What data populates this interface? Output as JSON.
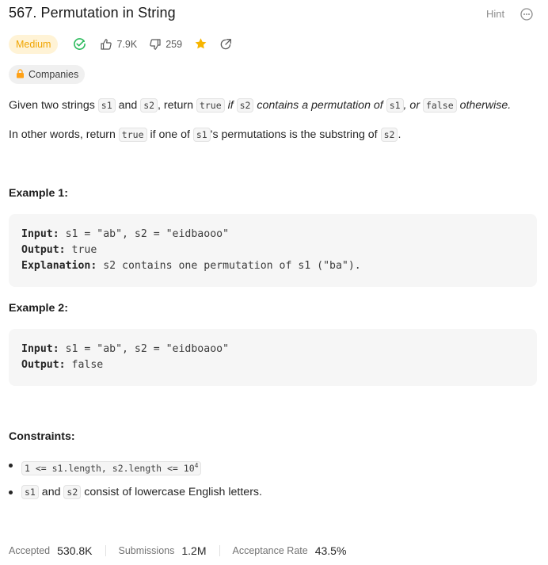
{
  "problem": {
    "title": "567. Permutation in String",
    "hint_label": "Hint",
    "difficulty": "Medium",
    "likes": "7.9K",
    "dislikes": "259",
    "companies_label": "Companies"
  },
  "description": {
    "p1": [
      {
        "t": "Given two strings ",
        "s": "text"
      },
      {
        "t": "s1",
        "s": "code"
      },
      {
        "t": " and ",
        "s": "text"
      },
      {
        "t": "s2",
        "s": "code"
      },
      {
        "t": ", return ",
        "s": "text"
      },
      {
        "t": "true",
        "s": "code"
      },
      {
        "t": " if ",
        "s": "it"
      },
      {
        "t": "s2",
        "s": "code"
      },
      {
        "t": " contains a permutation of ",
        "s": "it"
      },
      {
        "t": "s1",
        "s": "code"
      },
      {
        "t": ", or ",
        "s": "it"
      },
      {
        "t": "false",
        "s": "code"
      },
      {
        "t": " otherwise.",
        "s": "it"
      }
    ],
    "p2": [
      {
        "t": "In other words, return ",
        "s": "text"
      },
      {
        "t": "true",
        "s": "code"
      },
      {
        "t": " if one of ",
        "s": "text"
      },
      {
        "t": "s1",
        "s": "code"
      },
      {
        "t": "'s permutations is the substring of ",
        "s": "text"
      },
      {
        "t": "s2",
        "s": "code"
      },
      {
        "t": ".",
        "s": "text"
      }
    ]
  },
  "examples": [
    {
      "heading": "Example 1:",
      "lines": [
        {
          "label": "Input:",
          "value": " s1 = \"ab\", s2 = \"eidbaooo\""
        },
        {
          "label": "Output:",
          "value": " true"
        },
        {
          "label": "Explanation:",
          "value": " s2 contains one permutation of s1 (\"ba\")."
        }
      ]
    },
    {
      "heading": "Example 2:",
      "lines": [
        {
          "label": "Input:",
          "value": " s1 = \"ab\", s2 = \"eidboaoo\""
        },
        {
          "label": "Output:",
          "value": " false"
        }
      ]
    }
  ],
  "constraints": {
    "heading": "Constraints:",
    "c1_code": "1 <= s1.length, s2.length <= 10",
    "c1_sup": "4",
    "c2": [
      {
        "t": "s1",
        "s": "code"
      },
      {
        "t": " and ",
        "s": "text"
      },
      {
        "t": "s2",
        "s": "code"
      },
      {
        "t": " consist of lowercase English letters.",
        "s": "text"
      }
    ]
  },
  "stats": {
    "accepted_label": "Accepted",
    "accepted_value": "530.8K",
    "submissions_label": "Submissions",
    "submissions_value": "1.2M",
    "rate_label": "Acceptance Rate",
    "rate_value": "43.5%"
  },
  "colors": {
    "difficulty_text": "#f0a500",
    "difficulty_bg": "#fff3d6",
    "solved_green": "#2cbb5d",
    "star": "#f7b500"
  }
}
